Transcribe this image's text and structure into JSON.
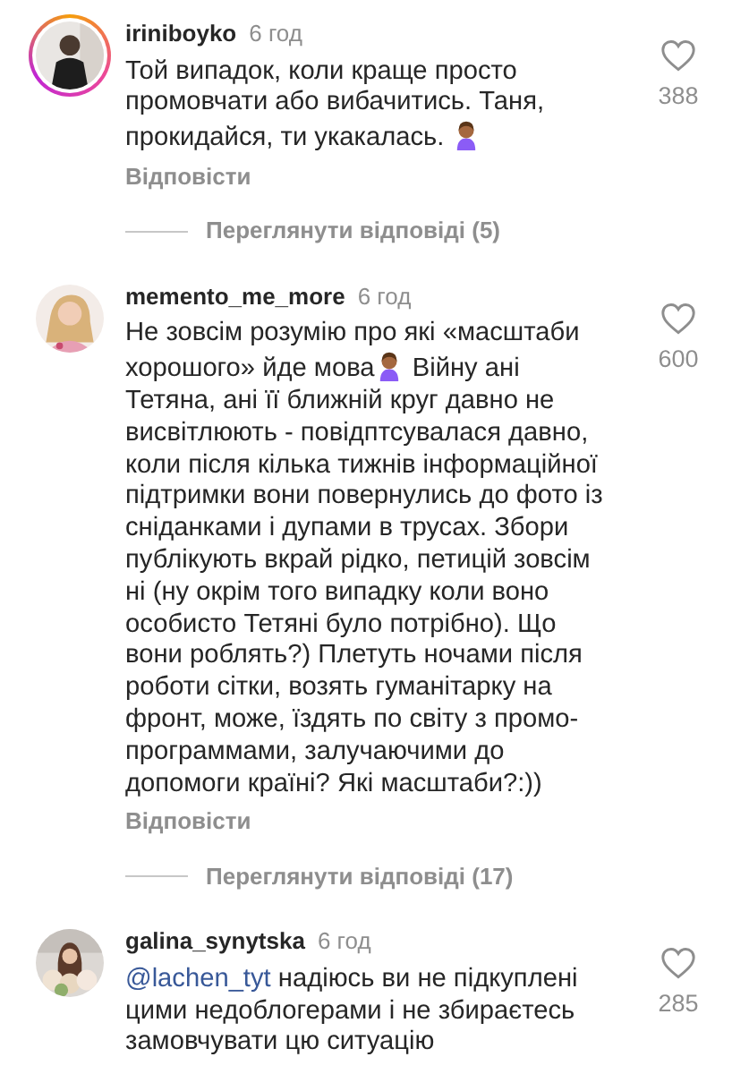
{
  "comments": [
    {
      "username": "iriniboyko",
      "time": "6 год",
      "story_ring": true,
      "likes": "388",
      "reply": "Відповісти",
      "view_replies": "Переглянути відповіді (5)",
      "body": [
        {
          "kind": "text",
          "text": "Той випадок, коли краще просто промовчати або вибачитись. Таня, прокидайся, ти укакалась. "
        },
        {
          "kind": "emoji"
        }
      ]
    },
    {
      "username": "memento_me_more",
      "time": "6 год",
      "story_ring": false,
      "likes": "600",
      "reply": "Відповісти",
      "view_replies": "Переглянути відповіді (17)",
      "body": [
        {
          "kind": "text",
          "text": "Не зовсім розумію про які «масштаби хорошого» йде мова"
        },
        {
          "kind": "emoji"
        },
        {
          "kind": "text",
          "text": " Війну ані Тетяна, ані її ближній круг давно не висвітлюють - повідптсувалася давно, коли після кілька тижнів інформаційної підтримки вони повернулись до фото із сніданками і дупами в трусах. Збори публікують вкрай рідко, петицій зовсім ні (ну окрім того випадку коли воно особисто Тетяні було потрібно). Що вони роблять?) Плетуть ночами після роботи сітки, возять гуманітарку на фронт, може, їздять по світу з промо-программами, залучаючими до допомоги країні? Які масштаби?:))"
        }
      ]
    },
    {
      "username": "galina_synytska",
      "time": "6 год",
      "story_ring": false,
      "likes": "285",
      "body": [
        {
          "kind": "mention",
          "text": "@lachen_tyt"
        },
        {
          "kind": "text",
          "text": " надіюсь ви не підкуплені цими недоблогерами і не збираєтесь замовчувати цю ситуацію"
        }
      ]
    }
  ]
}
